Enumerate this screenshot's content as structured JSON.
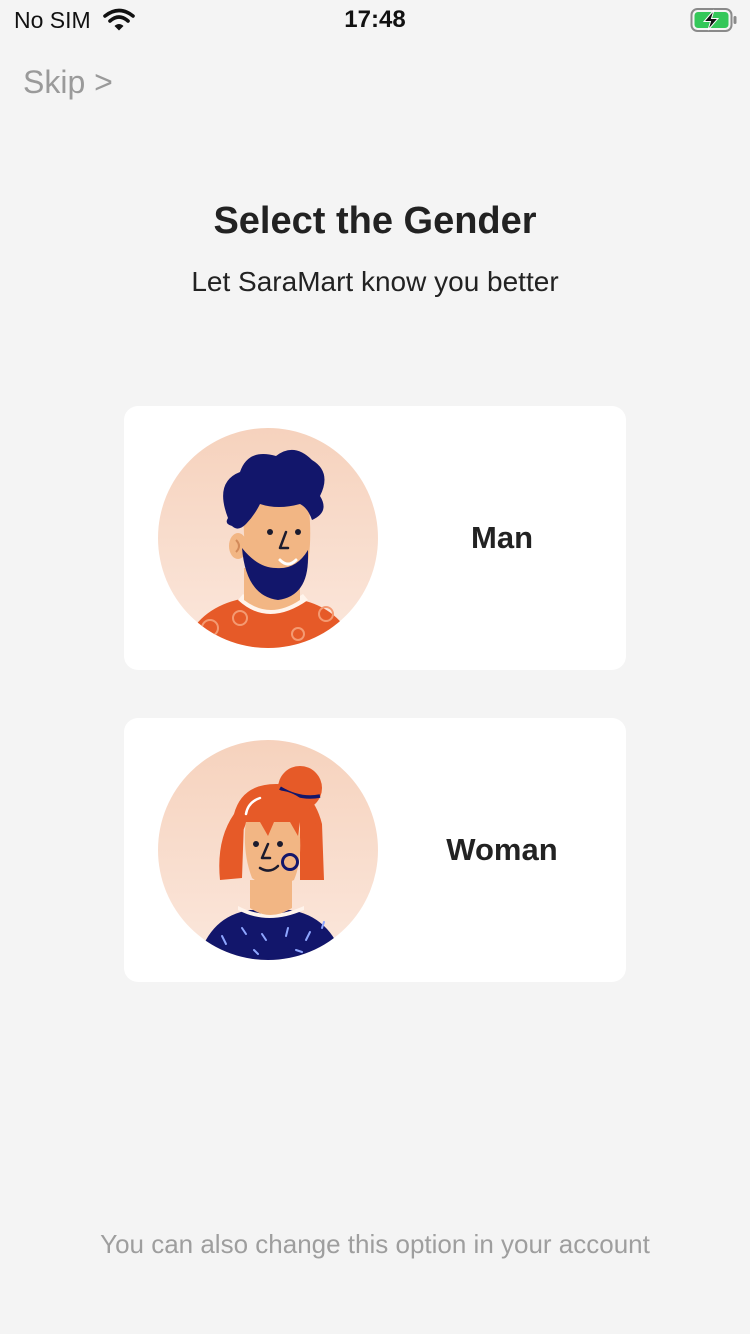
{
  "status_bar": {
    "carrier": "No SIM",
    "time": "17:48",
    "wifi_icon": "wifi-icon",
    "battery_icon": "battery-charging-icon",
    "battery_color": "#34c759"
  },
  "skip": {
    "label": "Skip >"
  },
  "header": {
    "title": "Select the Gender",
    "subtitle": "Let SaraMart know you better"
  },
  "options": [
    {
      "label": "Man",
      "avatar_icon": "man-avatar-icon"
    },
    {
      "label": "Woman",
      "avatar_icon": "woman-avatar-icon"
    }
  ],
  "footer": {
    "note": "You can also change this option in your account"
  },
  "colors": {
    "background": "#f4f4f4",
    "card": "#ffffff",
    "avatar_bg": "#f8dccb",
    "navy": "#12166b",
    "orange": "#e65a28",
    "skin": "#f2b684"
  }
}
